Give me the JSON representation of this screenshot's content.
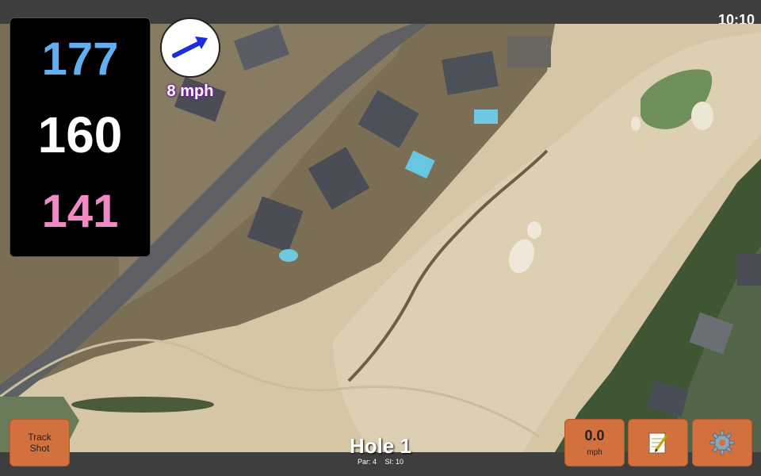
{
  "status_bar": {
    "time": "10:10"
  },
  "yardages": {
    "back": "177",
    "middle": "160",
    "front": "141"
  },
  "wind": {
    "speed_label": "8 mph",
    "icon": "wind-direction-arrow-icon"
  },
  "buttons": {
    "track_shot_line1": "Track",
    "track_shot_line2": "Shot",
    "speed_value": "0.0",
    "speed_unit": "mph",
    "notes_icon": "notepad-icon",
    "settings_icon": "gear-icon"
  },
  "hole": {
    "title": "Hole 1",
    "par": "Par: 4",
    "si": "SI: 10"
  },
  "colors": {
    "back_yardage": "#62aef0",
    "middle_yardage": "#ffffff",
    "front_yardage": "#ef8ac4",
    "button_orange": "#d2713e"
  }
}
